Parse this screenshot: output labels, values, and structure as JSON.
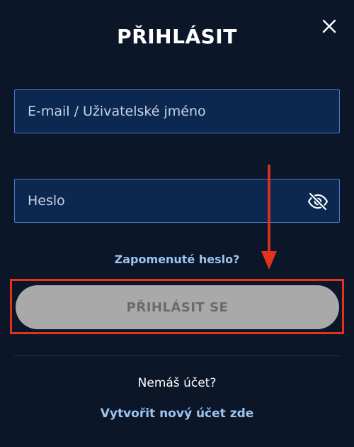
{
  "header": {
    "title": "PŘIHLÁSIT",
    "close_icon": "close-icon"
  },
  "form": {
    "email": {
      "placeholder": "E-mail / Uživatelské jméno",
      "value": ""
    },
    "password": {
      "placeholder": "Heslo",
      "value": "",
      "toggle_icon": "eye-off-icon"
    },
    "forgot_label": "Zapomenuté heslo?",
    "submit_label": "PŘIHLÁSIT SE"
  },
  "footer": {
    "no_account_text": "Nemáš účet?",
    "create_account_label": "Vytvořit nový účet zde"
  },
  "colors": {
    "background": "#0b1628",
    "input_background": "#0d2850",
    "input_border": "#4a78c2",
    "link": "#9cc4ee",
    "button_disabled": "#a9a9a9",
    "annotation_red": "#e5321b"
  }
}
